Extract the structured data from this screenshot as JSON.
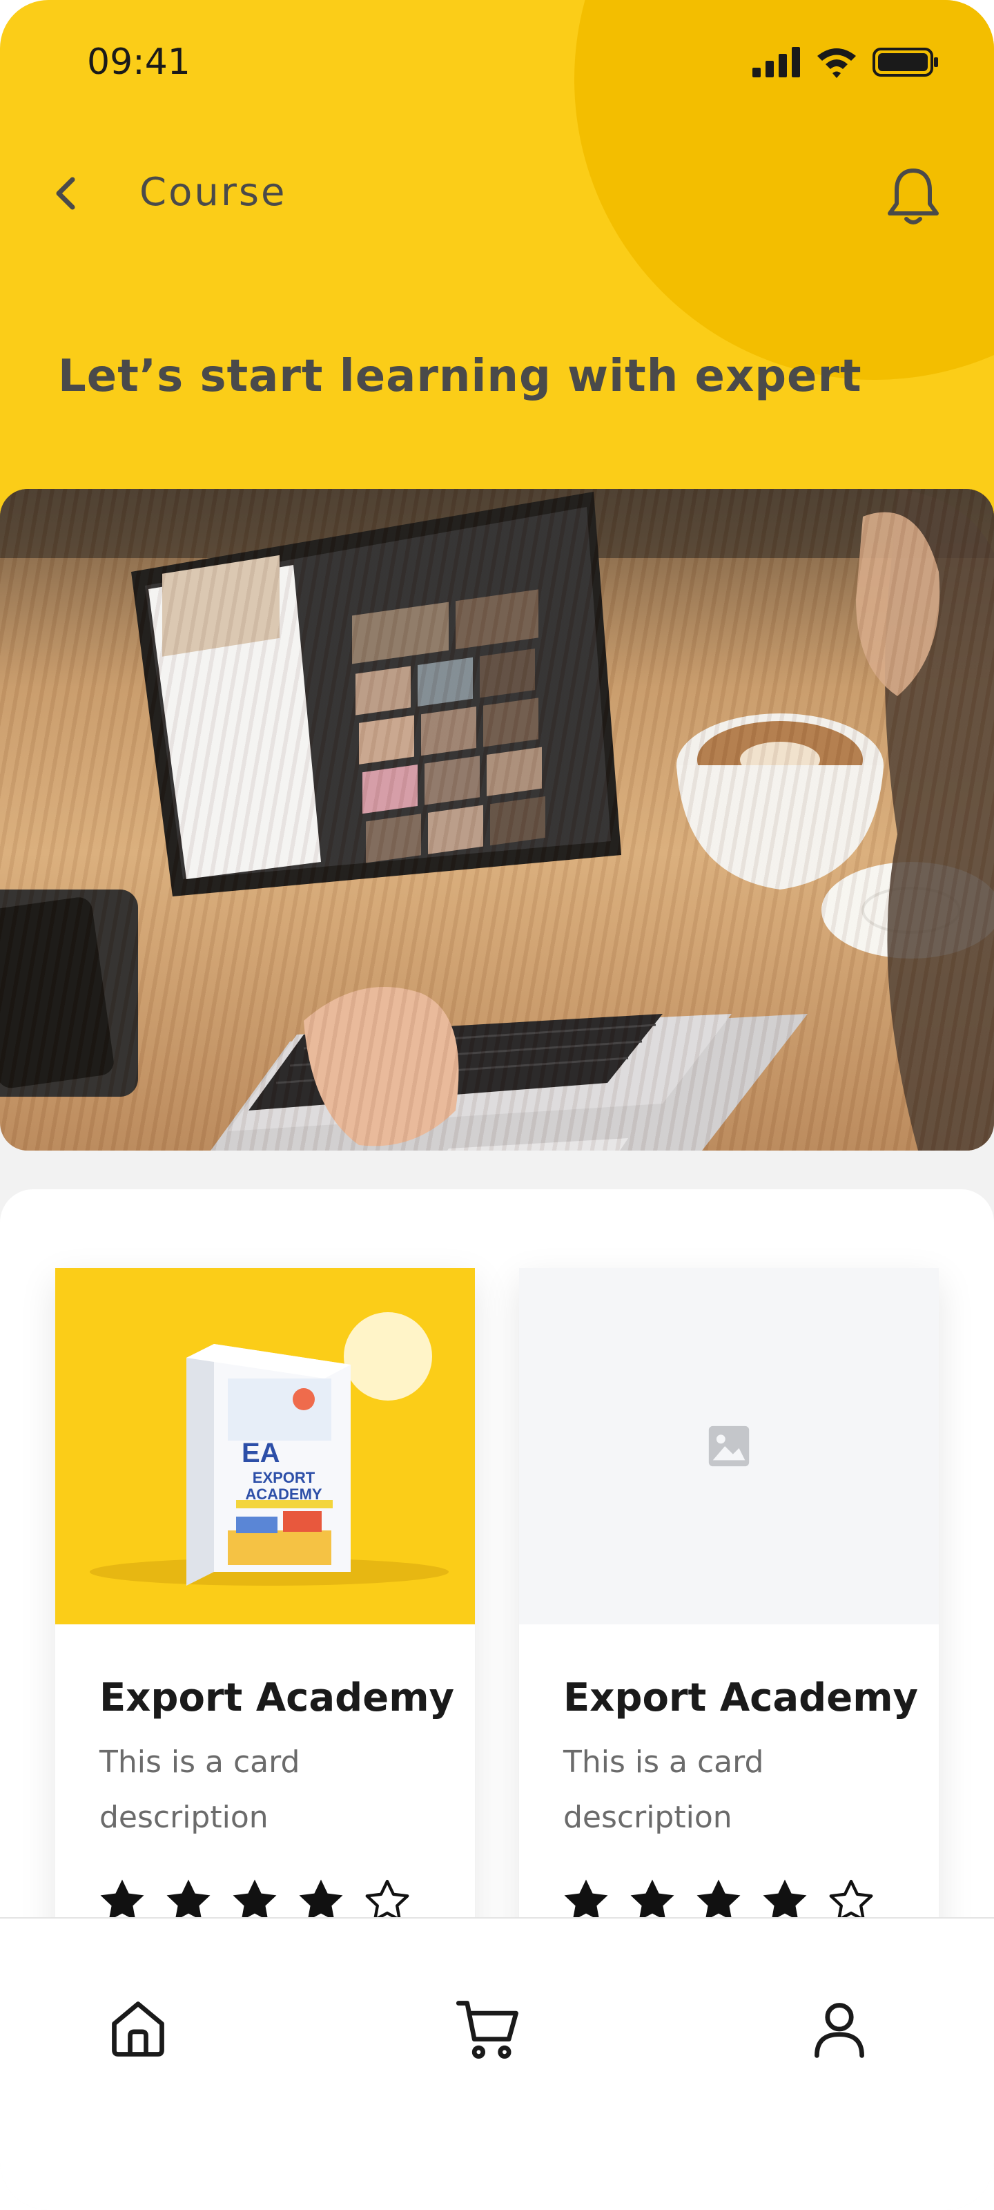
{
  "status_bar": {
    "time": "09:41"
  },
  "topbar": {
    "title": "Course"
  },
  "hero": {
    "heading": "Let’s start learning with expert"
  },
  "cards": [
    {
      "title": "Export Academy",
      "description": "This is a card description",
      "rating": 4,
      "rating_max": 5,
      "image": "export-academy-box"
    },
    {
      "title": "Export Academy",
      "description": "This is a card description",
      "rating": 4,
      "rating_max": 5,
      "image": "placeholder-image-icon"
    }
  ],
  "product_box": {
    "brand": "EXPORT ACADEMY",
    "monogram": "EA"
  },
  "bottom_nav": {
    "items": [
      "home-icon",
      "cart-icon",
      "profile-icon"
    ]
  },
  "colors": {
    "accent": "#fbcd18",
    "accent_dark": "#f3be00",
    "text_dark": "#4a4a4a"
  }
}
